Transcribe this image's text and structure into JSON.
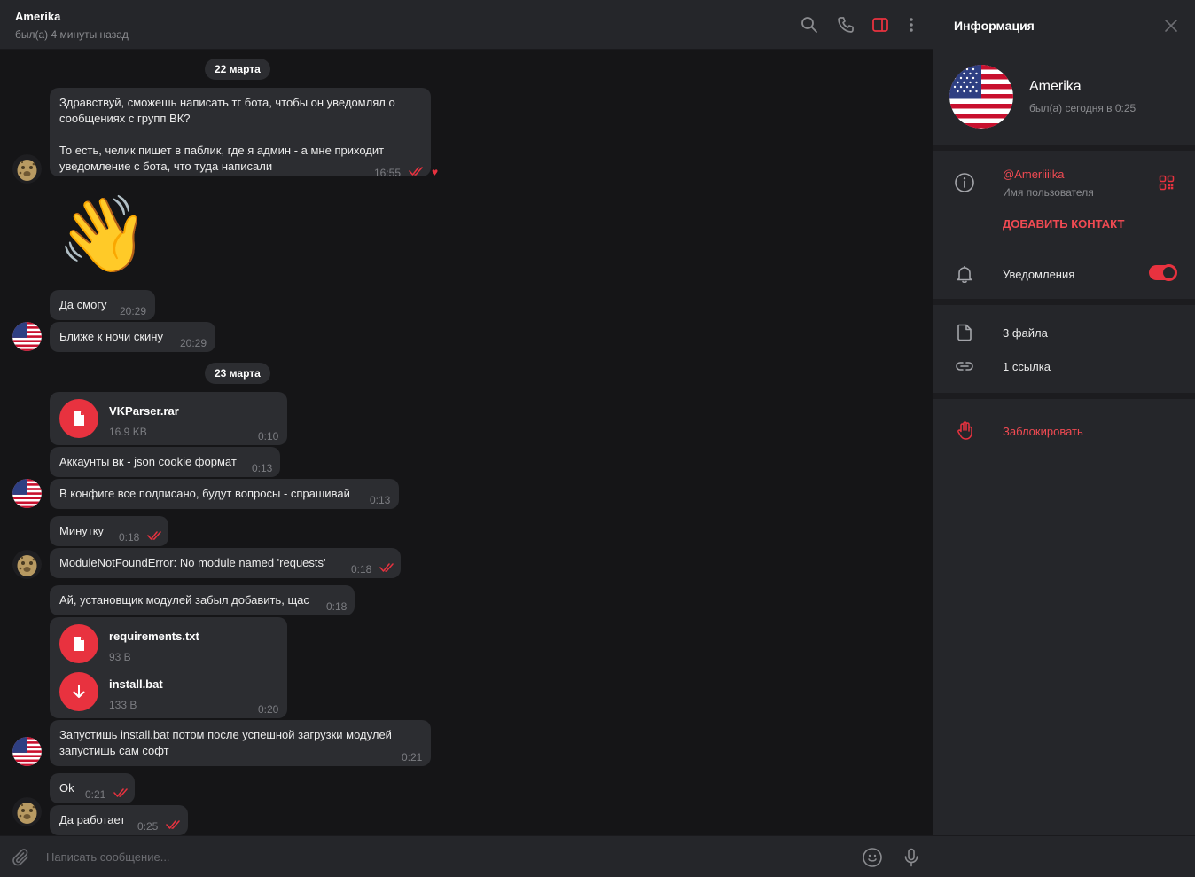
{
  "header": {
    "title": "Amerika",
    "status": "был(а) 4 минуты назад",
    "icons": [
      "search-icon",
      "phone-icon",
      "sidebar-toggle-icon",
      "more-vert-icon"
    ]
  },
  "colors": {
    "accent": "#e8323f",
    "bubble": "#2c2d31",
    "chat_bg": "#151517",
    "panel_bg": "#25262a"
  },
  "messages": {
    "date1": "22 марта",
    "m1_line1": "Здравствуй, сможешь написать тг бота, чтобы он уведомлял о",
    "m1_line2": "сообщениях с групп ВК?",
    "m1_line3": "То есть, челик пишет в паблик, где я админ - а мне приходит",
    "m1_line4": "уведомление с бота, что туда написали",
    "m1_time": "16:55",
    "m1_reaction": "♥",
    "m2_sticker": "👋",
    "m3_text": "Да смогу",
    "m3_time": "20:29",
    "m4_text": "Ближе к ночи скину",
    "m4_time": "20:29",
    "date2": "23 марта",
    "f1_name": "VKParser.rar",
    "f1_size": "16.9 KB",
    "f1_time": "0:10",
    "m5_text": "Аккаунты вк - json cookie формат",
    "m5_time": "0:13",
    "m6_text": "В конфиге все подписано, будут вопросы - спрашивай",
    "m6_time": "0:13",
    "m7_text": "Минутку",
    "m7_time": "0:18",
    "m8_text": "ModuleNotFoundError: No module named 'requests'",
    "m8_time": "0:18",
    "m9_text": "Ай, установщик модулей забыл добавить, щас",
    "m9_time": "0:18",
    "f2_name": "requirements.txt",
    "f2_size": "93 B",
    "f3_name": "install.bat",
    "f3_size": "133 B",
    "f23_time": "0:20",
    "m10_line1": "Запустишь install.bat потом после успешной загрузки модулей",
    "m10_line2": "запустишь сам софт",
    "m10_time": "0:21",
    "m11_text": "Ok",
    "m11_time": "0:21",
    "m12_text": "Да работает",
    "m12_time": "0:25"
  },
  "composer": {
    "placeholder": "Написать сообщение..."
  },
  "info": {
    "title": "Информация",
    "name": "Amerika",
    "status": "был(а) сегодня в 0:25",
    "username": "@Ameriiiika",
    "username_label": "Имя пользователя",
    "add_contact": "ДОБАВИТЬ КОНТАКТ",
    "notifications": "Уведомления",
    "notifications_on": true,
    "files": "3 файла",
    "links": "1 ссылка",
    "block": "Заблокировать"
  }
}
